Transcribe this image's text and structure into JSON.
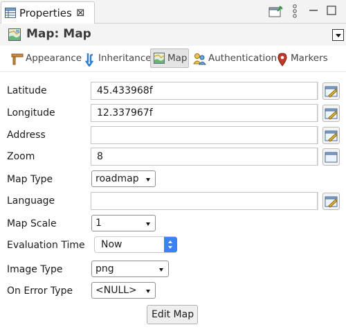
{
  "view_tab": {
    "title": "Properties",
    "close": "⊠"
  },
  "header": {
    "title": "Map: Map"
  },
  "tabs": [
    {
      "label": "Appearance",
      "icon": "appearance-icon"
    },
    {
      "label": "Inheritance",
      "icon": "inheritance-icon"
    },
    {
      "label": "Map",
      "icon": "map-icon",
      "active": true
    },
    {
      "label": "Authentication",
      "icon": "authentication-icon"
    },
    {
      "label": "Markers",
      "icon": "markers-icon"
    }
  ],
  "form": {
    "latitude": {
      "label": "Latitude",
      "value": "45.433968f"
    },
    "longitude": {
      "label": "Longitude",
      "value": "12.337967f"
    },
    "address": {
      "label": "Address",
      "value": ""
    },
    "zoom": {
      "label": "Zoom",
      "value": "8"
    },
    "map_type": {
      "label": "Map Type",
      "value": "roadmap"
    },
    "language": {
      "label": "Language",
      "value": ""
    },
    "map_scale": {
      "label": "Map Scale",
      "value": "1"
    },
    "evaluation_time": {
      "label": "Evaluation Time",
      "value": "Now"
    },
    "image_type": {
      "label": "Image Type",
      "value": "png"
    },
    "on_error_type": {
      "label": "On Error Type",
      "value": "<NULL>"
    }
  },
  "edit_map_label": "Edit Map",
  "colors": {
    "accent": "#3b82f6",
    "tab_active_bg": "#e4e4e4"
  }
}
